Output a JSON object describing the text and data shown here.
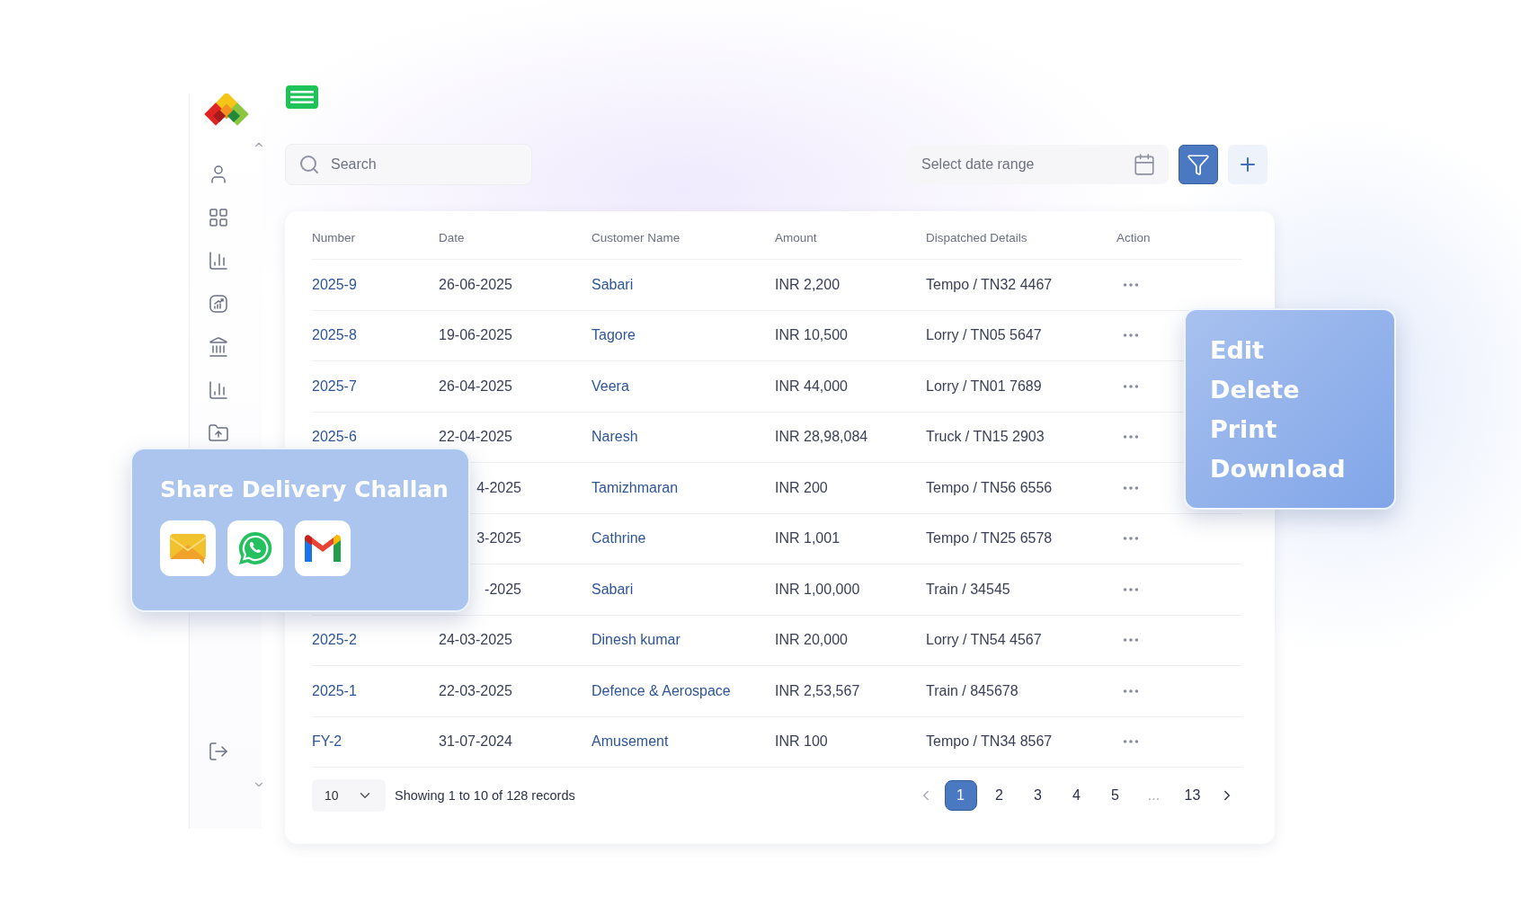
{
  "search": {
    "placeholder": "Search"
  },
  "date_range": {
    "placeholder": "Select date range"
  },
  "table": {
    "columns": [
      "Number",
      "Date",
      "Customer Name",
      "Amount",
      "Dispatched Details",
      "Action"
    ],
    "rows": [
      {
        "number": "2025-9",
        "date": "26-06-2025",
        "customer": "Sabari",
        "amount": "INR 2,200",
        "dispatched": "Tempo / TN32 4467"
      },
      {
        "number": "2025-8",
        "date": "19-06-2025",
        "customer": "Tagore",
        "amount": "INR 10,500",
        "dispatched": "Lorry / TN05 5647"
      },
      {
        "number": "2025-7",
        "date": "26-04-2025",
        "customer": "Veera",
        "amount": "INR 44,000",
        "dispatched": "Lorry / TN01 7689"
      },
      {
        "number": "2025-6",
        "date": "22-04-2025",
        "customer": "Naresh",
        "amount": "INR 28,98,084",
        "dispatched": "Truck / TN15 2903"
      },
      {
        "date": "4-2025",
        "customer": "Tamizhmaran",
        "amount": "INR 200",
        "dispatched": "Tempo / TN56 6556"
      },
      {
        "date": "3-2025",
        "customer": "Cathrine",
        "amount": "INR 1,001",
        "dispatched": "Tempo / TN25 6578"
      },
      {
        "date": "-2025",
        "customer": "Sabari",
        "amount": "INR 1,00,000",
        "dispatched": "Train / 34545"
      },
      {
        "number": "2025-2",
        "date": "24-03-2025",
        "customer": "Dinesh kumar",
        "amount": "INR 20,000",
        "dispatched": "Lorry / TN54 4567"
      },
      {
        "number": "2025-1",
        "date": "22-03-2025",
        "customer": "Defence & Aerospace",
        "amount": "INR 2,53,567",
        "dispatched": "Train / 845678"
      },
      {
        "number": "FY-2",
        "date": "31-07-2024",
        "customer": "Amusement",
        "amount": "INR 100",
        "dispatched": "Tempo / TN34 8567"
      }
    ]
  },
  "footer": {
    "page_size": "10",
    "summary": "Showing 1 to 10 of 128 records",
    "pages": [
      {
        "label": "1",
        "kind": "page",
        "selected": true
      },
      {
        "label": "2",
        "kind": "page",
        "selected": false
      },
      {
        "label": "3",
        "kind": "page",
        "selected": false
      },
      {
        "label": "4",
        "kind": "page",
        "selected": false
      },
      {
        "label": "5",
        "kind": "page",
        "selected": false
      },
      {
        "label": "...",
        "kind": "ellipsis",
        "selected": false
      },
      {
        "label": "13",
        "kind": "page",
        "selected": false
      }
    ]
  },
  "action_menu": {
    "items": [
      "Edit",
      "Delete",
      "Print",
      "Download"
    ]
  },
  "share_popup": {
    "title": "Share Delivery Challan"
  }
}
